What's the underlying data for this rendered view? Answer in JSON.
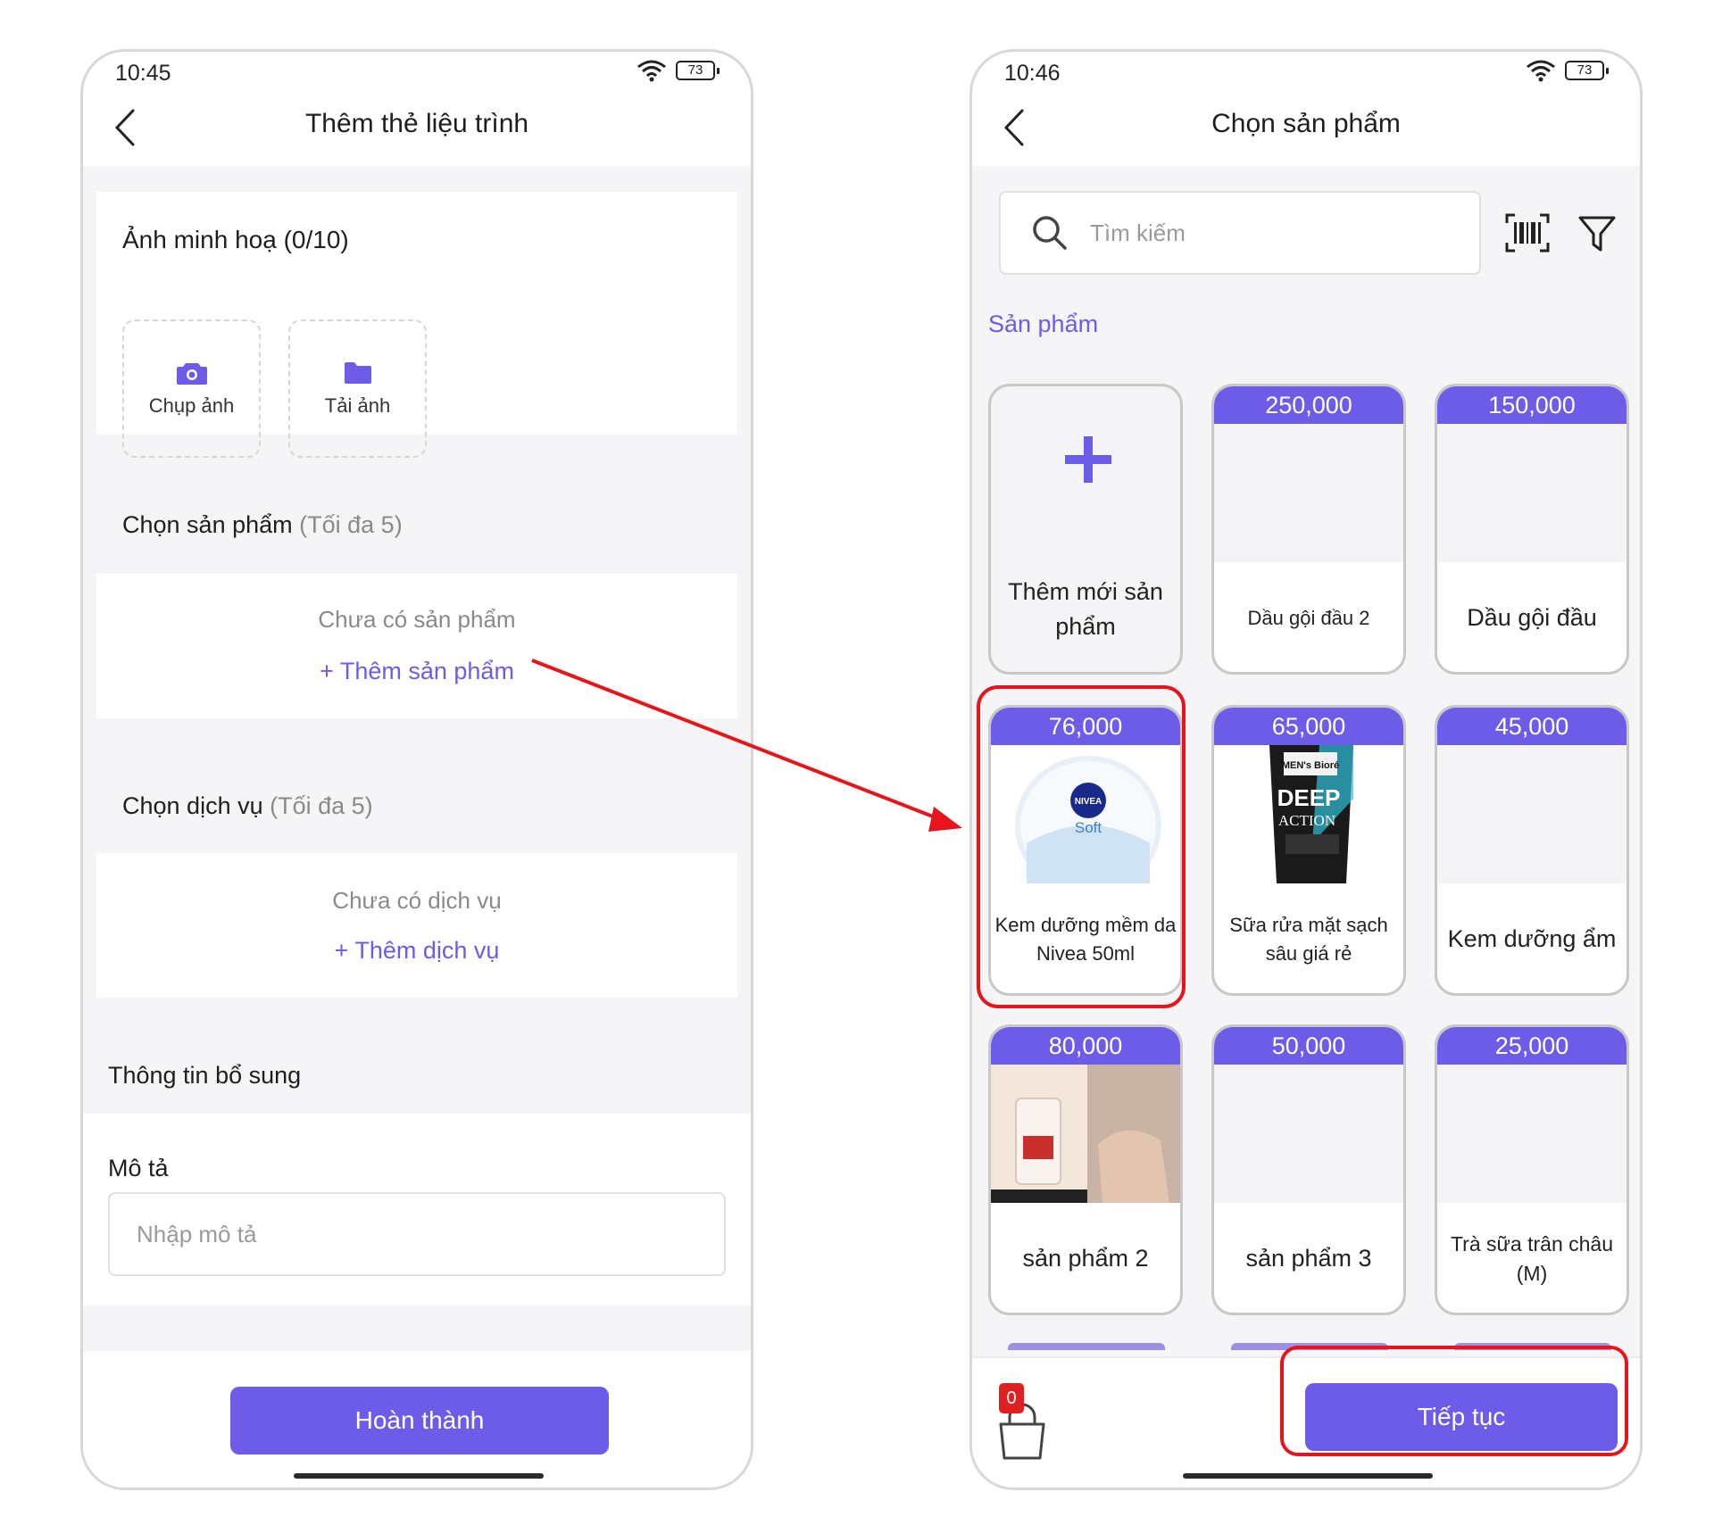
{
  "left_screen": {
    "status_time": "10:45",
    "battery": "73",
    "title": "Thêm thẻ liệu trình",
    "images_section": {
      "label": "Ảnh minh hoạ (0/10)",
      "take_photo": "Chụp ảnh",
      "upload_photo": "Tải ảnh"
    },
    "products_section": {
      "label": "Chọn sản phẩm",
      "hint": "(Tối đa 5)",
      "empty_text": "Chưa có sản phẩm",
      "add_link": "+ Thêm sản phẩm"
    },
    "services_section": {
      "label": "Chọn dịch vụ",
      "hint": "(Tối đa 5)",
      "empty_text": "Chưa có dịch vụ",
      "add_link": "+ Thêm dịch vụ"
    },
    "extra_info": {
      "label": "Thông tin bổ sung"
    },
    "description": {
      "label": "Mô tả",
      "placeholder": "Nhập mô tả"
    },
    "done_button": "Hoàn thành"
  },
  "right_screen": {
    "status_time": "10:46",
    "battery": "73",
    "title": "Chọn sản phẩm",
    "search": {
      "placeholder": "Tìm kiếm"
    },
    "category_label": "Sản phẩm",
    "add_new_tile": {
      "label": "Thêm mới sản phẩm"
    },
    "products": [
      {
        "price": "250,000",
        "name": "Dầu gội đầu 2",
        "image": ""
      },
      {
        "price": "150,000",
        "name": "Dầu gội đầu",
        "image": ""
      },
      {
        "price": "76,000",
        "name": "Kem dưỡng mềm da Nivea 50ml",
        "image": "nivea-cream",
        "image_text": {
          "brand": "NIVEA",
          "sub": "Soft"
        }
      },
      {
        "price": "65,000",
        "name": "Sữa rửa mặt sạch sâu giá rẻ",
        "image": "biore-tube",
        "image_text": {
          "brand": "MEN's Bioré",
          "line1": "DEEP",
          "line2": "ACTION"
        }
      },
      {
        "price": "45,000",
        "name": "Kem dưỡng ẩm",
        "image": ""
      },
      {
        "price": "80,000",
        "name": "sản phẩm 2",
        "image": "loreal-collage"
      },
      {
        "price": "50,000",
        "name": "sản phẩm 3",
        "image": ""
      },
      {
        "price": "25,000",
        "name": "Trà sữa trân châu (M)",
        "image": ""
      }
    ],
    "cart": {
      "count": "0"
    },
    "next_button": "Tiếp tục"
  },
  "colors": {
    "accent": "#6c5ce7",
    "annotation": "#e8141c",
    "badge": "#e02020"
  },
  "icons": [
    "back-icon",
    "wifi-icon",
    "battery-icon",
    "camera-icon",
    "folder-icon",
    "search-icon",
    "barcode-icon",
    "filter-icon",
    "plus-icon",
    "cart-icon"
  ]
}
